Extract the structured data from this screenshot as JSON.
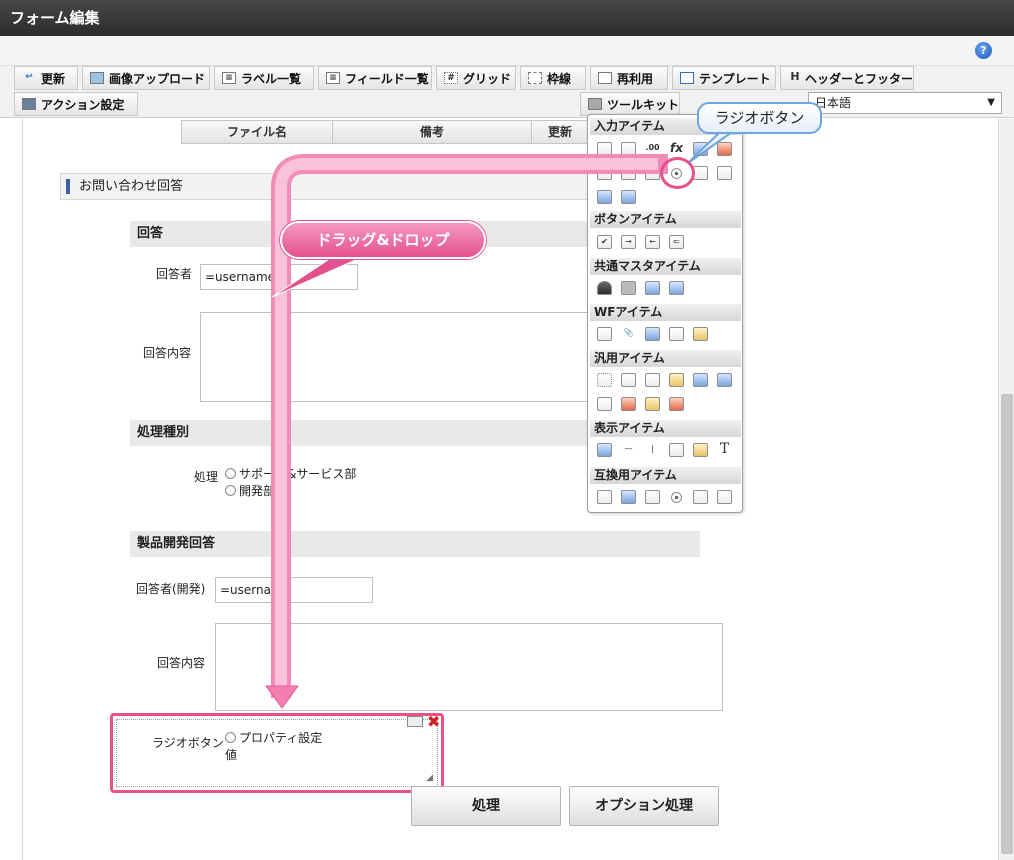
{
  "window": {
    "title": "フォーム編集",
    "help_icon": "help-icon",
    "help_glyph": "?"
  },
  "toolbar": {
    "buttons": [
      {
        "label": "更新",
        "icon": "update-icon"
      },
      {
        "label": "画像アップロード",
        "icon": "image-upload-icon"
      },
      {
        "label": "ラベル一覧",
        "icon": "label-list-icon"
      },
      {
        "label": "フィールド一覧",
        "icon": "field-list-icon"
      },
      {
        "label": "グリッド",
        "icon": "grid-icon"
      },
      {
        "label": "枠線",
        "icon": "border-icon"
      },
      {
        "label": "再利用",
        "icon": "reuse-icon"
      },
      {
        "label": "テンプレート",
        "icon": "template-icon"
      },
      {
        "label": "ヘッダーとフッター",
        "icon": "header-footer-icon"
      },
      {
        "label": "アクション設定",
        "icon": "action-settings-icon"
      },
      {
        "label": "ツールキット",
        "icon": "toolkit-icon"
      }
    ],
    "language": {
      "selected": "日本語"
    }
  },
  "file_table": {
    "headers": [
      "ファイル名",
      "備考",
      "更新"
    ]
  },
  "form": {
    "main_title": "お問い合わせ回答",
    "sections": {
      "answer": "回答",
      "processing_type": "処理種別",
      "dev_answer": "製品開発回答"
    },
    "fields": {
      "responder_label": "回答者",
      "responder_value": "=username()",
      "content_label": "回答内容",
      "processing_label": "処理",
      "processing_options": [
        "サポート&サービス部",
        "開発部"
      ],
      "dev_responder_label": "回答者(開発)",
      "dev_responder_value": "=username",
      "dev_content_label": "回答内容"
    },
    "dropped_item": {
      "label": "ラジオボタン",
      "option_text": "プロパティ設定",
      "option_text2": "値"
    },
    "buttons": {
      "process": "処理",
      "option_process": "オプション処理"
    }
  },
  "palette": {
    "groups": [
      {
        "title": "入力アイテム"
      },
      {
        "title": "ボタンアイテム"
      },
      {
        "title": "共通マスタアイテム"
      },
      {
        "title": "WFアイテム"
      },
      {
        "title": "汎用アイテム"
      },
      {
        "title": "表示アイテム"
      },
      {
        "title": "互換用アイテム"
      }
    ],
    "fx_glyph": "fx",
    "text_glyph": "T"
  },
  "annotations": {
    "radio_callout": "ラジオボタン",
    "drag_drop": "ドラッグ&ドロップ"
  },
  "colors": {
    "accent": "#e8508a",
    "callout_border": "#6ea5dc",
    "title_bar": "#333333"
  }
}
